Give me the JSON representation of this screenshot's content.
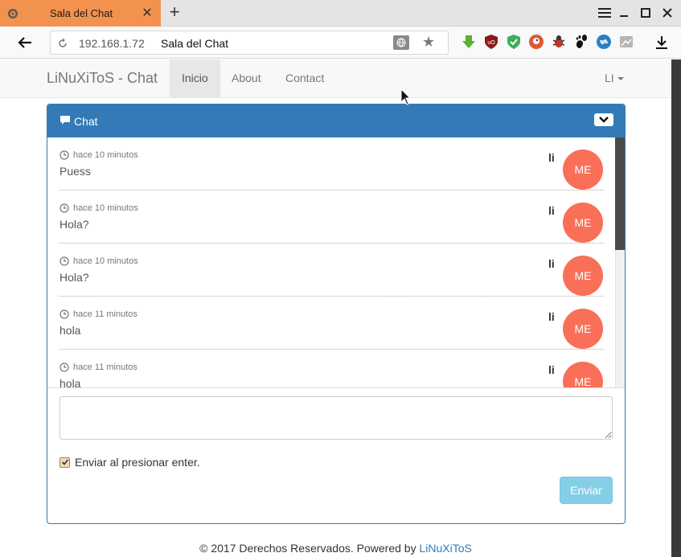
{
  "browser": {
    "tab_title": "Sala del Chat",
    "url_host": "192.168.1.72",
    "url_title": "Sala del Chat"
  },
  "navbar": {
    "brand": "LiNuXiToS - Chat",
    "items": [
      {
        "label": "Inicio",
        "active": true
      },
      {
        "label": "About",
        "active": false
      },
      {
        "label": "Contact",
        "active": false
      }
    ],
    "user": "LI"
  },
  "chat": {
    "title": "Chat",
    "messages": [
      {
        "time": "hace 10 minutos",
        "text": "Puess",
        "user": "li",
        "avatar": "ME"
      },
      {
        "time": "hace 10 minutos",
        "text": "Hola?",
        "user": "li",
        "avatar": "ME"
      },
      {
        "time": "hace 10 minutos",
        "text": "Hola?",
        "user": "li",
        "avatar": "ME"
      },
      {
        "time": "hace 11 minutos",
        "text": "hola",
        "user": "li",
        "avatar": "ME"
      },
      {
        "time": "hace 11 minutos",
        "text": "hola",
        "user": "li",
        "avatar": "ME"
      }
    ],
    "input_value": "",
    "enter_checkbox_label": "Enviar al presionar enter.",
    "enter_checkbox_checked": true,
    "send_label": "Enviar"
  },
  "footer": {
    "text": "© 2017 Derechos Reservados. Powered by ",
    "link": "LiNuXiToS"
  },
  "colors": {
    "tab_active": "#f3914f",
    "panel_primary": "#337ab7",
    "avatar": "#fa6f57",
    "send_button": "#5bc0de"
  }
}
